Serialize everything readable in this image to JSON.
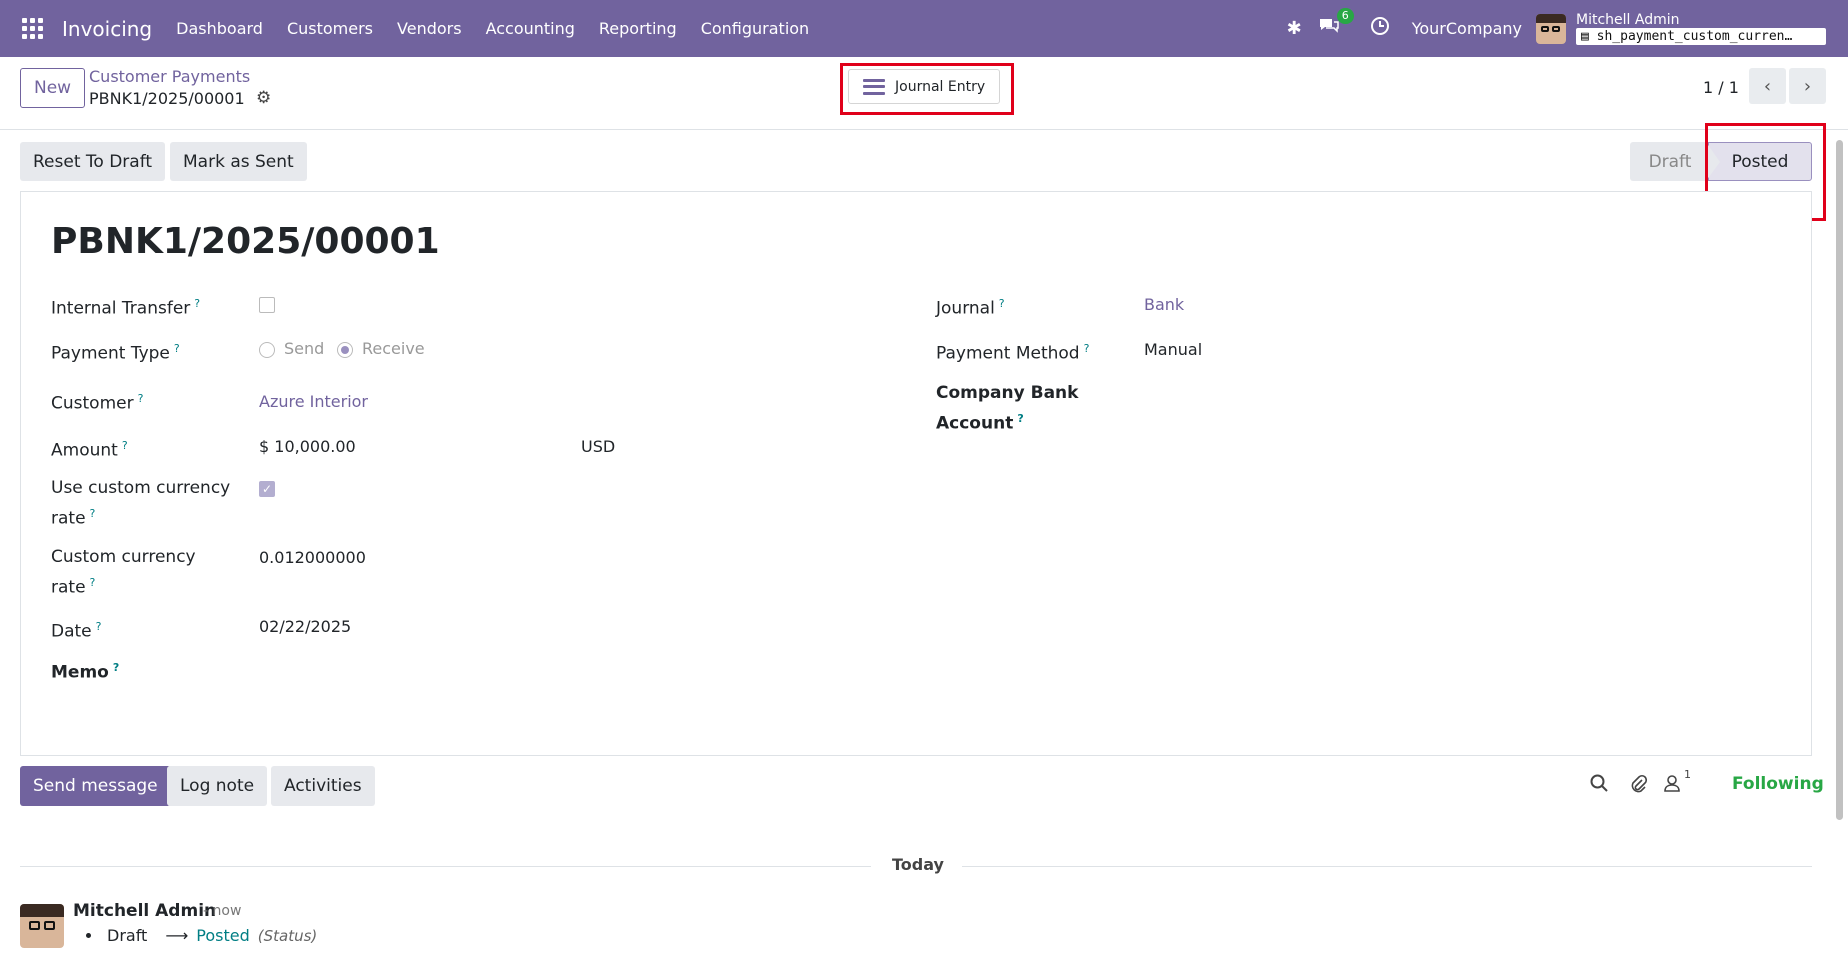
{
  "navbar": {
    "app_name": "Invoicing",
    "menu": [
      "Dashboard",
      "Customers",
      "Vendors",
      "Accounting",
      "Reporting",
      "Configuration"
    ],
    "chat_count": "6",
    "company": "YourCompany",
    "user": "Mitchell Admin",
    "database": "sh_payment_custom_curren…"
  },
  "control": {
    "new_label": "New",
    "breadcrumb_parent": "Customer Payments",
    "breadcrumb_current": "PBNK1/2025/00001",
    "smart_button": "Journal Entry",
    "pager": "1 / 1"
  },
  "actions": {
    "reset_to_draft": "Reset To Draft",
    "mark_as_sent": "Mark as Sent"
  },
  "statusbar": {
    "draft": "Draft",
    "posted": "Posted",
    "current": "Posted"
  },
  "form": {
    "title": "PBNK1/2025/00001",
    "internal_transfer_label": "Internal Transfer",
    "internal_transfer_checked": false,
    "payment_type_label": "Payment Type",
    "payment_type_send": "Send",
    "payment_type_receive": "Receive",
    "payment_type_value": "Receive",
    "customer_label": "Customer",
    "customer_value": "Azure Interior",
    "amount_label": "Amount",
    "amount_value": "$ 10,000.00",
    "currency_value": "USD",
    "custom_rate_label_1": "Use custom currency",
    "custom_rate_label_2": "rate",
    "custom_rate_checked": true,
    "custom_currency_rate_label_1": "Custom currency",
    "custom_currency_rate_label_2": "rate",
    "custom_currency_rate_value": "0.012000000",
    "date_label": "Date",
    "date_value": "02/22/2025",
    "memo_label": "Memo",
    "journal_label": "Journal",
    "journal_value": "Bank",
    "payment_method_label": "Payment Method",
    "payment_method_value": "Manual",
    "company_bank_label_1": "Company Bank",
    "company_bank_label_2": "Account",
    "help_mark": "?"
  },
  "chatter": {
    "send_message": "Send message",
    "log_note": "Log note",
    "activities": "Activities",
    "followers_count": "1",
    "following": "Following",
    "today": "Today",
    "message": {
      "author": "Mitchell Admin",
      "time": "- now",
      "old_value": "Draft",
      "new_value": "Posted",
      "field": "(Status)"
    }
  },
  "colors": {
    "brand": "#71639e",
    "following": "#28a745",
    "highlight": "#e0001a"
  }
}
